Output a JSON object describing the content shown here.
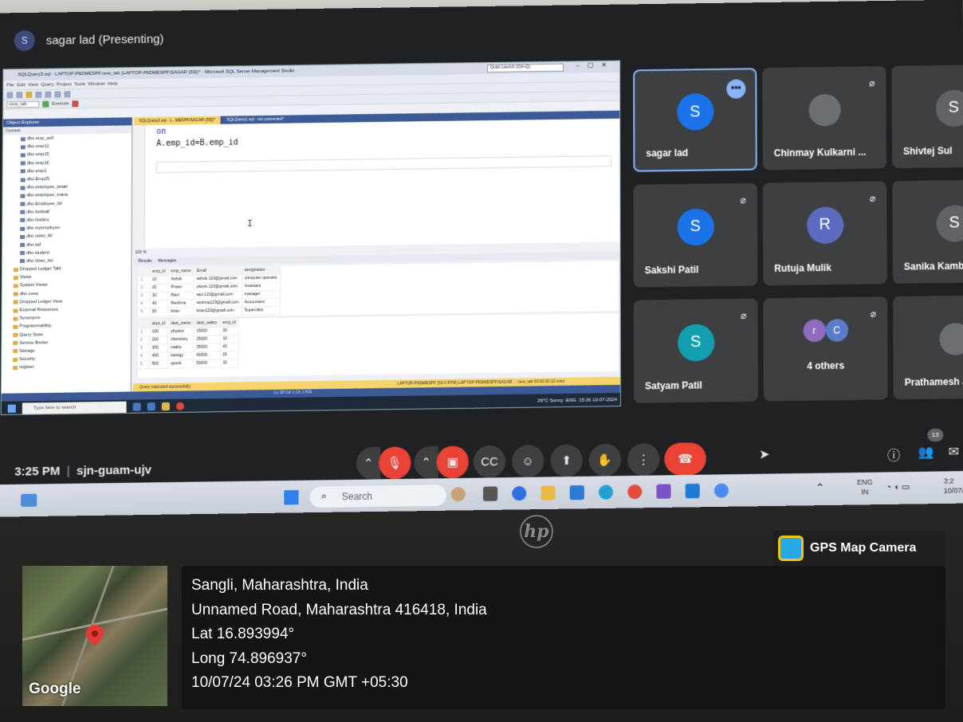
{
  "meet": {
    "presenter_banner": "sagar lad (Presenting)",
    "presenter_initial": "S",
    "clock": "3:25 PM",
    "separator": "|",
    "meeting_code": "sjn-guam-ujv",
    "participant_count": "13",
    "tiles": [
      {
        "name": "sagar lad",
        "initial": "S",
        "color": "#1a73e8"
      },
      {
        "name": "Chinmay Kulkarni ...",
        "initial": "",
        "color": "#5f6368"
      },
      {
        "name": "Shivtej Sul",
        "initial": "S",
        "color": "#5f6368"
      },
      {
        "name": "Sakshi Patil",
        "initial": "S",
        "color": "#1a73e8"
      },
      {
        "name": "Rutuja Mulik",
        "initial": "R",
        "color": "#5c6bc0"
      },
      {
        "name": "Sanika Kamble",
        "initial": "S",
        "color": "#5f6368"
      },
      {
        "name": "Satyam Patil",
        "initial": "S",
        "color": "#129eaf"
      },
      {
        "name": "4 others",
        "initial": "",
        "color": ""
      },
      {
        "name": "Prathamesh Ja",
        "initial": "",
        "color": "#5f6368"
      }
    ],
    "others_initials": [
      "r",
      "C"
    ],
    "more_label": "•••"
  },
  "ssms": {
    "title": "SQLQuery3.sql - LAPTOP-P6DMESPF.new_tab (LAPTOP-P6DMESPF\\SAGAR (59))* - Microsoft SQL Server Management Studio",
    "quick_launch": "Quick Launch (Ctrl+Q)",
    "db_select": "new_tab",
    "execute_label": "Execute",
    "object_explorer": "Object Explorer",
    "connect_label": "Connect",
    "tree": [
      "dbo.emp_self",
      "dbo.emp12",
      "dbo.emp15",
      "dbo.emp16",
      "dbo.emp2",
      "dbo.Emp25",
      "dbo.employee_detail",
      "dbo.employee_mana",
      "dbo.Employee_tbl",
      "dbo.football",
      "dbo.hockey",
      "dbo.myemployee",
      "dbo.order_tbl",
      "dbo.std",
      "dbo.student",
      "dbo.Voter_list",
      "Dropped Ledger Tabl",
      "Views",
      "System Views",
      "dbo.vvew",
      "Dropped Ledger View",
      "External Resources",
      "Synonyms",
      "Programmability",
      "Query Store",
      "Service Broker",
      "Storage",
      "Security",
      "register"
    ],
    "tabs": [
      "SQLQuery3.sql - L...MESPF\\SAGAR (59))*",
      "SQLQuery1.sql - not connected*"
    ],
    "code_line1": "on",
    "code_line2": "A.emp_id=B.emp_id",
    "zoom": "100 %",
    "results_tab": "Results",
    "messages_tab": "Messages",
    "grid1_headers": [
      "emp_id",
      "emp_name",
      "Email",
      "designation"
    ],
    "grid1_rows": [
      [
        "1",
        "10",
        "Ashok",
        "ashok.123@gmail.com",
        "computer operator"
      ],
      [
        "2",
        "20",
        "Pravin",
        "pravin.123@gmail.com",
        "Assistant"
      ],
      [
        "3",
        "30",
        "Ravi",
        "ravi.123@gmail.com",
        "manager"
      ],
      [
        "4",
        "40",
        "Reshma",
        "reshma123@gmail.com",
        "Accountant"
      ],
      [
        "5",
        "50",
        "kiran",
        "kiran123@gmail.com",
        "Supervisor"
      ]
    ],
    "grid2_headers": [
      "dept_id",
      "dept_name",
      "dept_salary",
      "emp_id"
    ],
    "grid2_rows": [
      [
        "1",
        "100",
        "physics",
        "15000",
        "30"
      ],
      [
        "2",
        "200",
        "chemistry",
        "25000",
        "10"
      ],
      [
        "3",
        "300",
        "maths",
        "35000",
        "40"
      ],
      [
        "4",
        "400",
        "biology",
        "40000",
        "20"
      ],
      [
        "5",
        "500",
        "sports",
        "50000",
        "10"
      ]
    ],
    "status_ok": "Query executed successfully.",
    "status_server": "LAPTOP-P6DMESPF (16.0 RTM)   LAPTOP-P6DMESPF\\SAGAR ...   new_tab   00:00:00   10 rows",
    "ln_col": "Ln 18     Col 1     Ch 1     INS",
    "task_search": "Type here to search",
    "weather": "29°C Sunny",
    "task_time": "15:26",
    "task_date": "10-07-2024",
    "task_lang": "ENG"
  },
  "laptop_taskbar": {
    "search": "Search",
    "lang": "ENG",
    "region": "IN",
    "time": "3:2",
    "date": "10/07/"
  },
  "gps": {
    "badge": "GPS Map Camera",
    "map_label": "Google",
    "line1": "Sangli, Maharashtra, India",
    "line2": "Unnamed Road, Maharashtra 416418, India",
    "line3": "Lat 16.893994°",
    "line4": "Long 74.896937°",
    "line5": "10/07/24 03:26 PM GMT +05:30"
  },
  "brand": {
    "logo": "hp"
  }
}
